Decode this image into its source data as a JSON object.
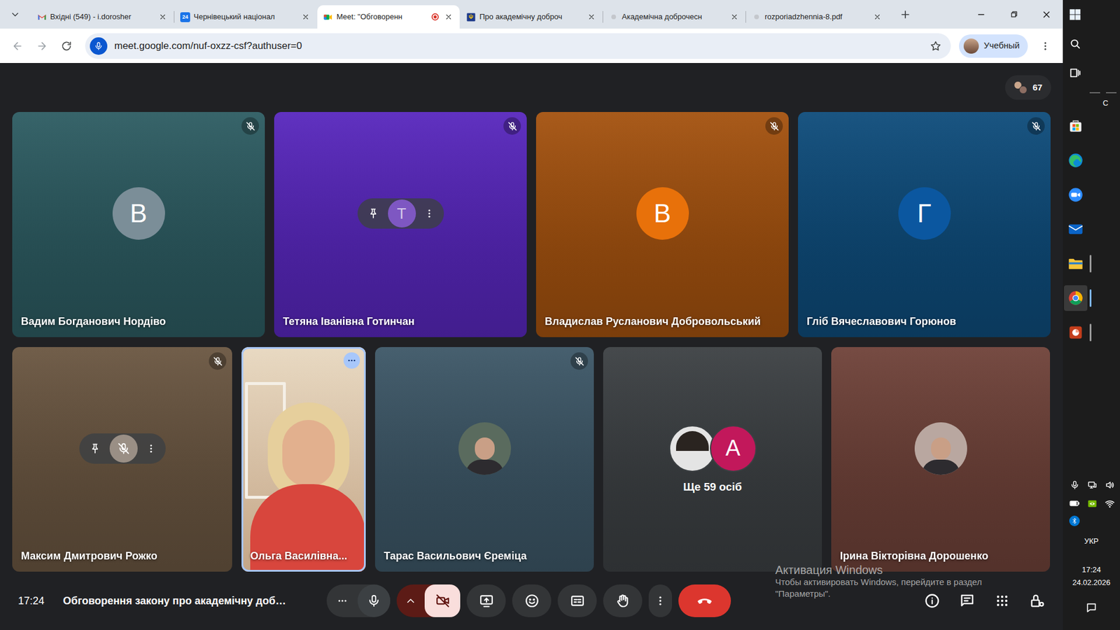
{
  "browser": {
    "tabs": [
      {
        "label": "Вхідні (549) - i.dorosher",
        "kind": "gmail",
        "selected": false,
        "recording": false
      },
      {
        "label": "Чернівецький націонал",
        "kind": "calendar",
        "icon_text": "24",
        "selected": false,
        "recording": false
      },
      {
        "label": "Meet: \"Обговоренн",
        "kind": "meet",
        "selected": true,
        "recording": true
      },
      {
        "label": "Про академічну доброч",
        "kind": "rada",
        "selected": false,
        "recording": false
      },
      {
        "label": "Академічна доброчесн",
        "kind": "loading",
        "selected": false,
        "recording": false
      },
      {
        "label": "rozporiadzhennia-8.pdf",
        "kind": "loading",
        "selected": false,
        "recording": false
      }
    ],
    "address_bar": {
      "url": "meet.google.com/nuf-oxzz-csf?authuser=0",
      "bookmarked": false
    },
    "profile": {
      "label": "Учебный"
    }
  },
  "meet": {
    "participant_count": "67",
    "tiles": [
      {
        "name": "Вадим Богданович Нордіво",
        "kind": "letter",
        "avatar": "В",
        "muted": true,
        "hovered": false,
        "highlighted": false,
        "color": "#2d5c62",
        "avatar_color": "#7b8e98"
      },
      {
        "name": "Тетяна Іванівна Готинчан",
        "kind": "letter",
        "avatar": "Т",
        "muted": true,
        "hovered": true,
        "highlighted": false,
        "color": "#5827bd",
        "avatar_color": "#7e57c2"
      },
      {
        "name": "Владислав Русланович Добровольський",
        "kind": "letter",
        "avatar": "В",
        "muted": true,
        "hovered": false,
        "highlighted": false,
        "color": "#a4520f",
        "avatar_color": "#e8710a"
      },
      {
        "name": "Гліб Вячеславович Горюнов",
        "kind": "letter",
        "avatar": "Г",
        "muted": true,
        "hovered": false,
        "highlighted": false,
        "color": "#0e4c7b",
        "avatar_color": "#0b57a0"
      },
      {
        "name": "Максим Дмитрович Рожко",
        "kind": "photo",
        "muted": true,
        "hovered": true,
        "highlighted": false,
        "color": "#6a5641",
        "avatar_color": "#9a8f85"
      },
      {
        "name": "Ольга Василівна...",
        "kind": "video",
        "muted": false,
        "hovered": false,
        "highlighted": true,
        "color": "#d8c2a4"
      },
      {
        "name": "Тарас Васильович Єреміца",
        "kind": "photo",
        "muted": true,
        "hovered": false,
        "highlighted": false,
        "color": "#3d5767",
        "avatar_color": "#5a6b5e"
      },
      {
        "label": "Ще 59 осіб",
        "kind": "group",
        "muted": false,
        "hovered": false,
        "highlighted": false,
        "color": "#3c4043",
        "avatars": [
          {
            "kind": "photo",
            "color": "#e4e4e4"
          },
          {
            "kind": "letter",
            "letter": "А",
            "color": "#c2185b"
          }
        ]
      },
      {
        "name": "Ірина Вікторівна Дорошенко",
        "kind": "photo",
        "muted": false,
        "hovered": false,
        "highlighted": false,
        "color": "#6f4239",
        "avatar_color": "#b9a7a0"
      }
    ],
    "bottom_bar": {
      "time": "17:24",
      "title": "Обговорення закону про академічну доб…",
      "mic_on": true,
      "camera_on": false,
      "hand_raised": false
    }
  },
  "watermark": {
    "title": "Активация Windows",
    "lines": [
      "Чтобы активировать Windows, перейдите в раздел",
      "\"Параметры\"."
    ]
  },
  "taskbar": {
    "widget_text": "С",
    "apps": [
      {
        "kind": "store",
        "open": false,
        "active": false
      },
      {
        "kind": "edge",
        "open": false,
        "active": false
      },
      {
        "kind": "zoom",
        "open": false,
        "active": false
      },
      {
        "kind": "mail",
        "open": false,
        "active": false
      },
      {
        "kind": "explorer",
        "open": true,
        "active": false
      },
      {
        "kind": "chrome",
        "open": true,
        "active": true
      },
      {
        "kind": "powerpoint",
        "open": true,
        "active": false
      }
    ],
    "tray": {
      "language": "УКР",
      "time": "17:24",
      "date": "24.02.2026"
    }
  }
}
